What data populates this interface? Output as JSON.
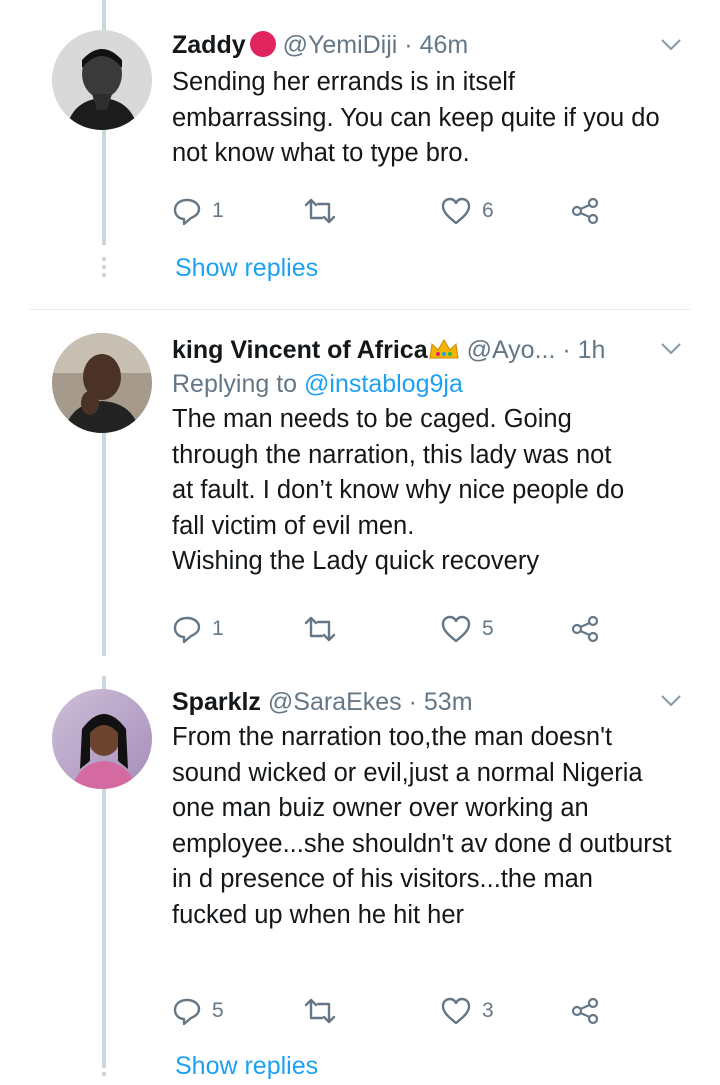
{
  "tweets": [
    {
      "name": "Zaddy",
      "badge": "red-circle",
      "handle": "@YemiDiji",
      "time": "46m",
      "text": "Sending her errands is in itself embarrassing. You can keep quite if you do not know what to type bro.",
      "replies": "1",
      "retweets": "",
      "likes": "6",
      "show_replies": "Show replies"
    },
    {
      "name": "king Vincent of Africa",
      "badge": "crown",
      "handle": "@Ayo...",
      "time": "1h",
      "replying_prefix": "Replying to ",
      "replying_to": "@instablog9ja",
      "text_lines": [
        "The man needs to be caged. Going",
        "through the narration, this lady was not",
        "at fault. I don’t know why nice people do",
        "fall victim of evil men.",
        "Wishing the Lady quick recovery"
      ],
      "replies": "1",
      "retweets": "",
      "likes": "5"
    },
    {
      "name": "Sparklz",
      "handle": "@SaraEkes",
      "time": "53m",
      "text": "From the narration too,the man doesn't sound wicked or evil,just a normal Nigeria one man buiz owner over working an employee...she shouldn't av done d outburst in d presence of his visitors...the man fucked up when he hit her",
      "replies": "5",
      "retweets": "",
      "likes": "3",
      "show_replies": "Show replies"
    }
  ],
  "colors": {
    "accent": "#1da1f2",
    "muted": "#657786",
    "line": "#ccd6dd",
    "badge": "#e0245e"
  },
  "icons": [
    "reply-icon",
    "retweet-icon",
    "like-icon",
    "share-icon",
    "chevron-down-icon"
  ]
}
